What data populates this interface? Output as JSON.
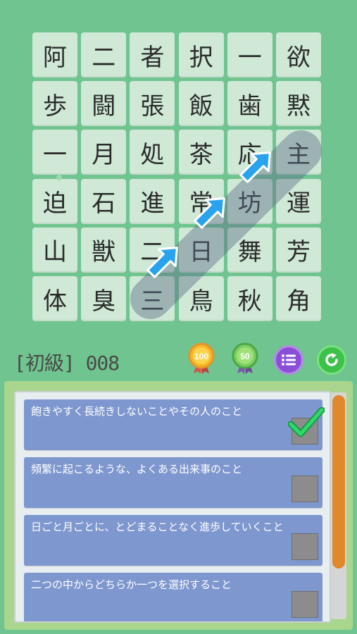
{
  "grid": [
    [
      "阿",
      "二",
      "者",
      "択",
      "一",
      "欲"
    ],
    [
      "歩",
      "闘",
      "張",
      "飯",
      "歯",
      "黙"
    ],
    [
      "一",
      "月",
      "処",
      "茶",
      "応",
      "主"
    ],
    [
      "迫",
      "石",
      "進",
      "常",
      "坊",
      "運"
    ],
    [
      "山",
      "獣",
      "二",
      "日",
      "舞",
      "芳"
    ],
    [
      "体",
      "臭",
      "三",
      "鳥",
      "秋",
      "角"
    ]
  ],
  "level": {
    "label": "[初級] 008"
  },
  "hud": {
    "medal_gold": "100",
    "medal_silver": "50",
    "menu_icon": "list-icon",
    "refresh_icon": "refresh-icon"
  },
  "colors": {
    "background": "#6fc48f",
    "cell": "#cfe9d6",
    "item": "#7f97cf",
    "check": "#1fc25a",
    "scroll_thumb": "#e0882b"
  },
  "clues": [
    {
      "text": "飽きやすく長続きしないことやその人のこと",
      "checked": true
    },
    {
      "text": "頻繁に起こるような、よくある出来事のこと",
      "checked": false
    },
    {
      "text": "日ごと月ごとに、とどまることなく進歩していくこと",
      "checked": false
    },
    {
      "text": "二つの中からどちらか一つを選択すること",
      "checked": false
    }
  ]
}
